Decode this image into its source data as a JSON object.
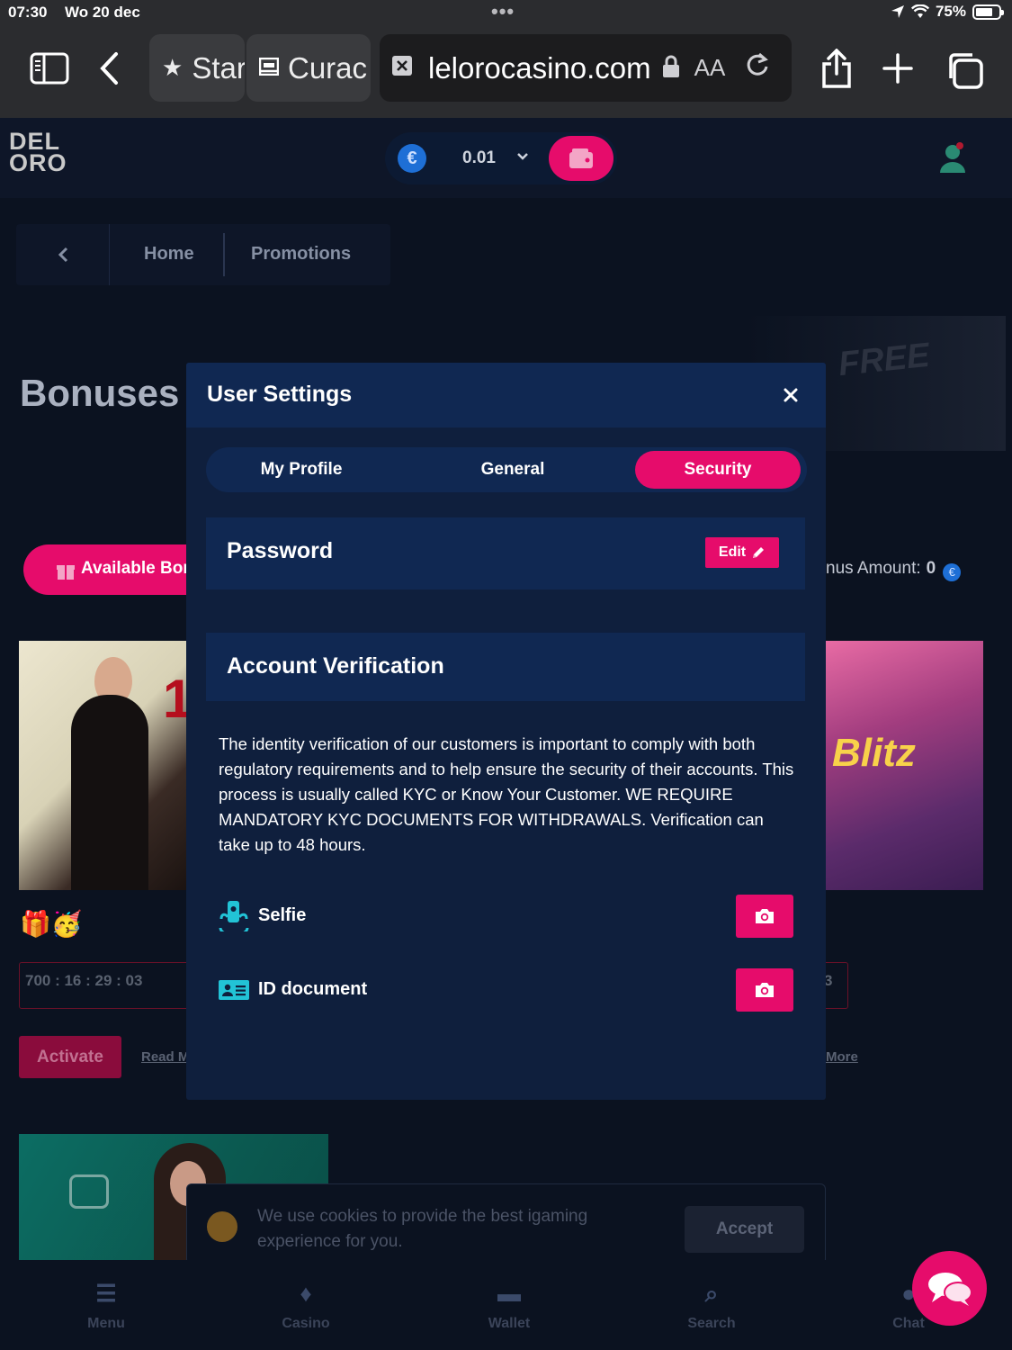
{
  "status_bar": {
    "time": "07:30",
    "date": "Wo 20 dec",
    "battery": "75%",
    "battery_level": 0.75
  },
  "browser": {
    "tabs": [
      {
        "label": "Star",
        "icon": "star-icon"
      },
      {
        "label": "Curac",
        "icon": "reader-icon"
      }
    ],
    "active_tab_url": "lelorocasino.com",
    "text_size_label": "AA"
  },
  "site": {
    "logo_line1": "DEL",
    "logo_line2": "ORO",
    "balance": "0.01",
    "currency_symbol": "€",
    "breadcrumb": {
      "home": "Home",
      "promotions": "Promotions"
    },
    "page_title": "Bonuses",
    "available_bonuses": "Available Bor",
    "bonus_amount_label": "nus Amount:",
    "bonus_amount_value": "0",
    "timer": "700 : 16 : 29 : 03",
    "timer_right": "3",
    "activate": "Activate",
    "read_more_left": "Read M",
    "read_more_right": "More",
    "bonus_card_word": "Blitz",
    "bonus_card_number": "1",
    "banner_word": "FREE"
  },
  "cookie": {
    "text": "We use cookies to provide the best igaming experience for you.",
    "accept": "Accept"
  },
  "bottom_nav": [
    {
      "label": "Menu",
      "icon": "menu-icon"
    },
    {
      "label": "Casino",
      "icon": "casino-icon"
    },
    {
      "label": "Wallet",
      "icon": "wallet-icon"
    },
    {
      "label": "Search",
      "icon": "search-icon"
    },
    {
      "label": "Chat",
      "icon": "chat-icon"
    }
  ],
  "modal": {
    "title": "User Settings",
    "tabs": [
      {
        "label": "My Profile"
      },
      {
        "label": "General"
      },
      {
        "label": "Security"
      }
    ],
    "active_tab": "Security",
    "password": {
      "label": "Password",
      "edit": "Edit"
    },
    "verification": {
      "title": "Account Verification",
      "description": "The identity verification of our customers is important to comply with both regulatory requirements and to help ensure the security of their accounts. This process is usually called KYC or Know Your Customer. WE REQUIRE MANDATORY KYC DOCUMENTS FOR WITHDRAWALS. Verification can take up to 48 hours.",
      "documents": [
        {
          "label": "Selfie",
          "icon": "selfie-icon"
        },
        {
          "label": "ID document",
          "icon": "id-card-icon"
        }
      ]
    }
  },
  "colors": {
    "accent": "#e60c6b",
    "modal_bg": "#0f1f3d",
    "panel_bg": "#102852",
    "icon_teal": "#22c3d6"
  }
}
